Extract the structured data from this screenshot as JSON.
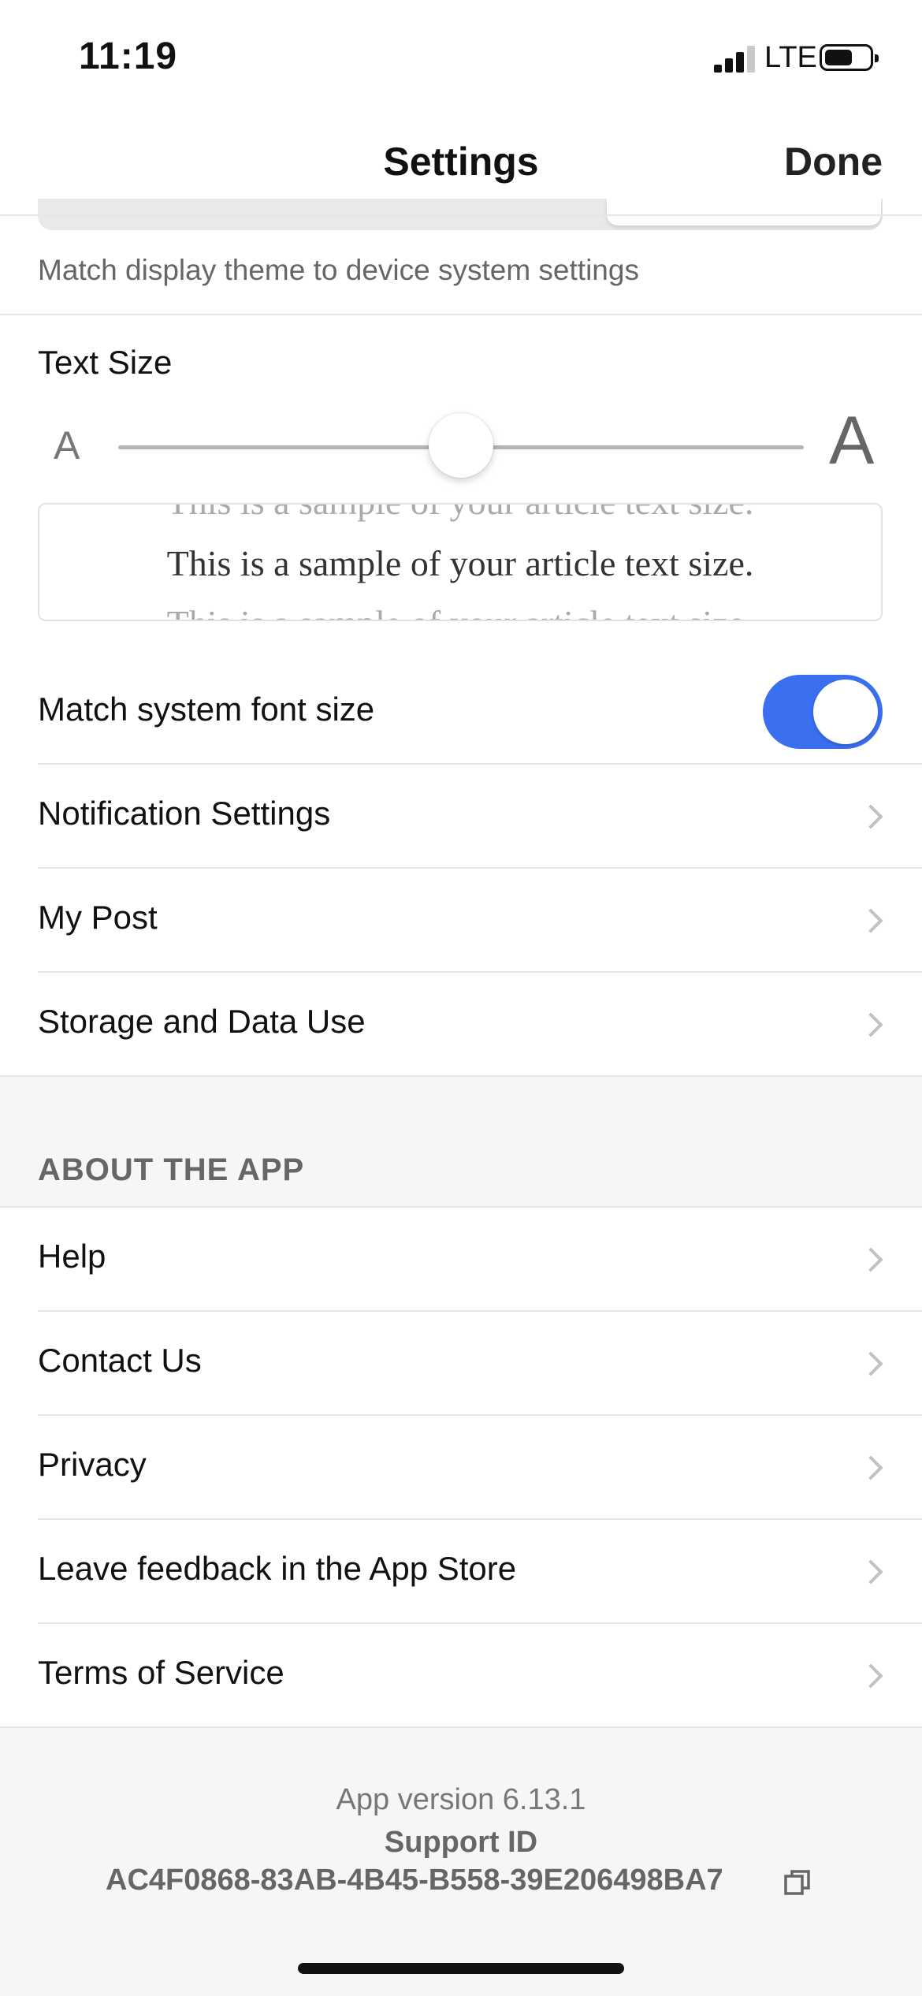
{
  "status_bar": {
    "time": "11:19",
    "network": "LTE",
    "signal_bars": 3,
    "signal_total": 4,
    "battery_level": 0.6
  },
  "nav": {
    "title": "Settings",
    "done_label": "Done"
  },
  "display": {
    "theme_description": "Match display theme to device system settings"
  },
  "text_size": {
    "label": "Text Size",
    "small_glyph": "A",
    "large_glyph": "A",
    "slider_value": 0.5,
    "sample_prev": "This is a sample of your article text size.",
    "sample_current": "This is a sample of your article text size.",
    "sample_next": "This is a sample of your article text size."
  },
  "settings_rows": {
    "match_font": {
      "label": "Match system font size",
      "enabled": true
    },
    "notifications": "Notification Settings",
    "my_post": "My Post",
    "storage": "Storage and Data Use"
  },
  "about": {
    "header": "ABOUT THE APP",
    "help": "Help",
    "contact": "Contact Us",
    "privacy": "Privacy",
    "feedback": "Leave feedback in the App Store",
    "terms": "Terms of Service"
  },
  "footer": {
    "app_version": "App version 6.13.1",
    "support_label": "Support ID",
    "support_id": "AC4F0868-83AB-4B45-B558-39E206498BA7"
  },
  "colors": {
    "accent": "#3a6ff0",
    "section_bg": "#f6f6f6",
    "divider": "#e6e6e6"
  },
  "icons": {
    "chevron": "chevron-right-icon",
    "copy": "copy-icon",
    "battery": "battery-icon",
    "signal": "signal-icon"
  }
}
